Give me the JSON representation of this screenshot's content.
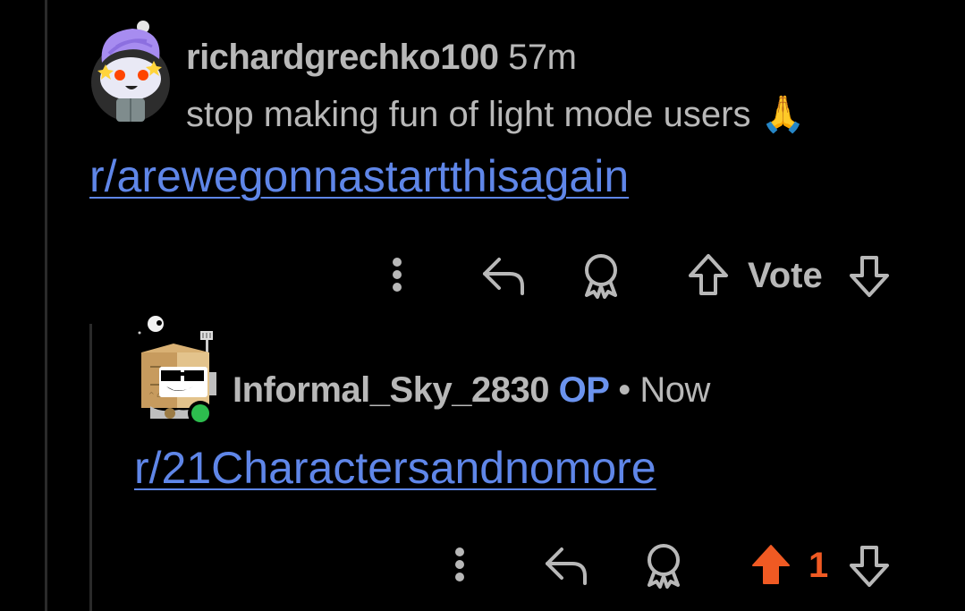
{
  "comments": [
    {
      "username": "richardgrechko100",
      "time": "57m",
      "text": "stop making fun of light mode users 🙏",
      "link": "r/arewegonnastartthisagain",
      "vote_label": "Vote"
    },
    {
      "username": "Informal_Sky_2830",
      "op_badge": "OP",
      "separator": "•",
      "time": "Now",
      "link": "r/21Charactersandnomore",
      "vote_count": "1"
    }
  ],
  "colors": {
    "background": "#000000",
    "text": "#b8b8b8",
    "link": "#5f86e8",
    "op": "#6b93ee",
    "upvote_active": "#f05a23"
  },
  "icons": [
    "more-icon",
    "reply-icon",
    "award-icon",
    "upvote-icon",
    "downvote-icon"
  ]
}
